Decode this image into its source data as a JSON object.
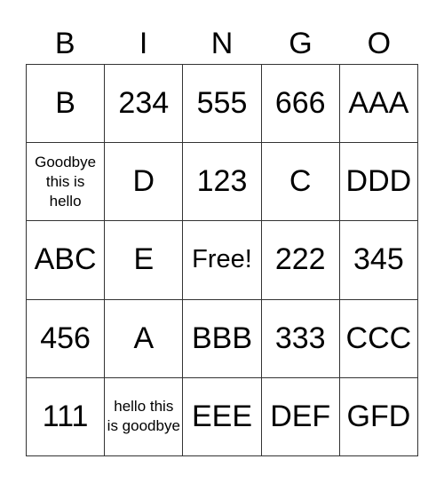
{
  "header": [
    "B",
    "I",
    "N",
    "G",
    "O"
  ],
  "rows": [
    [
      "B",
      "234",
      "555",
      "666",
      "AAA"
    ],
    [
      "Goodbye this is hello",
      "D",
      "123",
      "C",
      "DDD"
    ],
    [
      "ABC",
      "E",
      "Free!",
      "222",
      "345"
    ],
    [
      "456",
      "A",
      "BBB",
      "333",
      "CCC"
    ],
    [
      "111",
      "hello this is goodbye",
      "EEE",
      "DEF",
      "GFD"
    ]
  ]
}
